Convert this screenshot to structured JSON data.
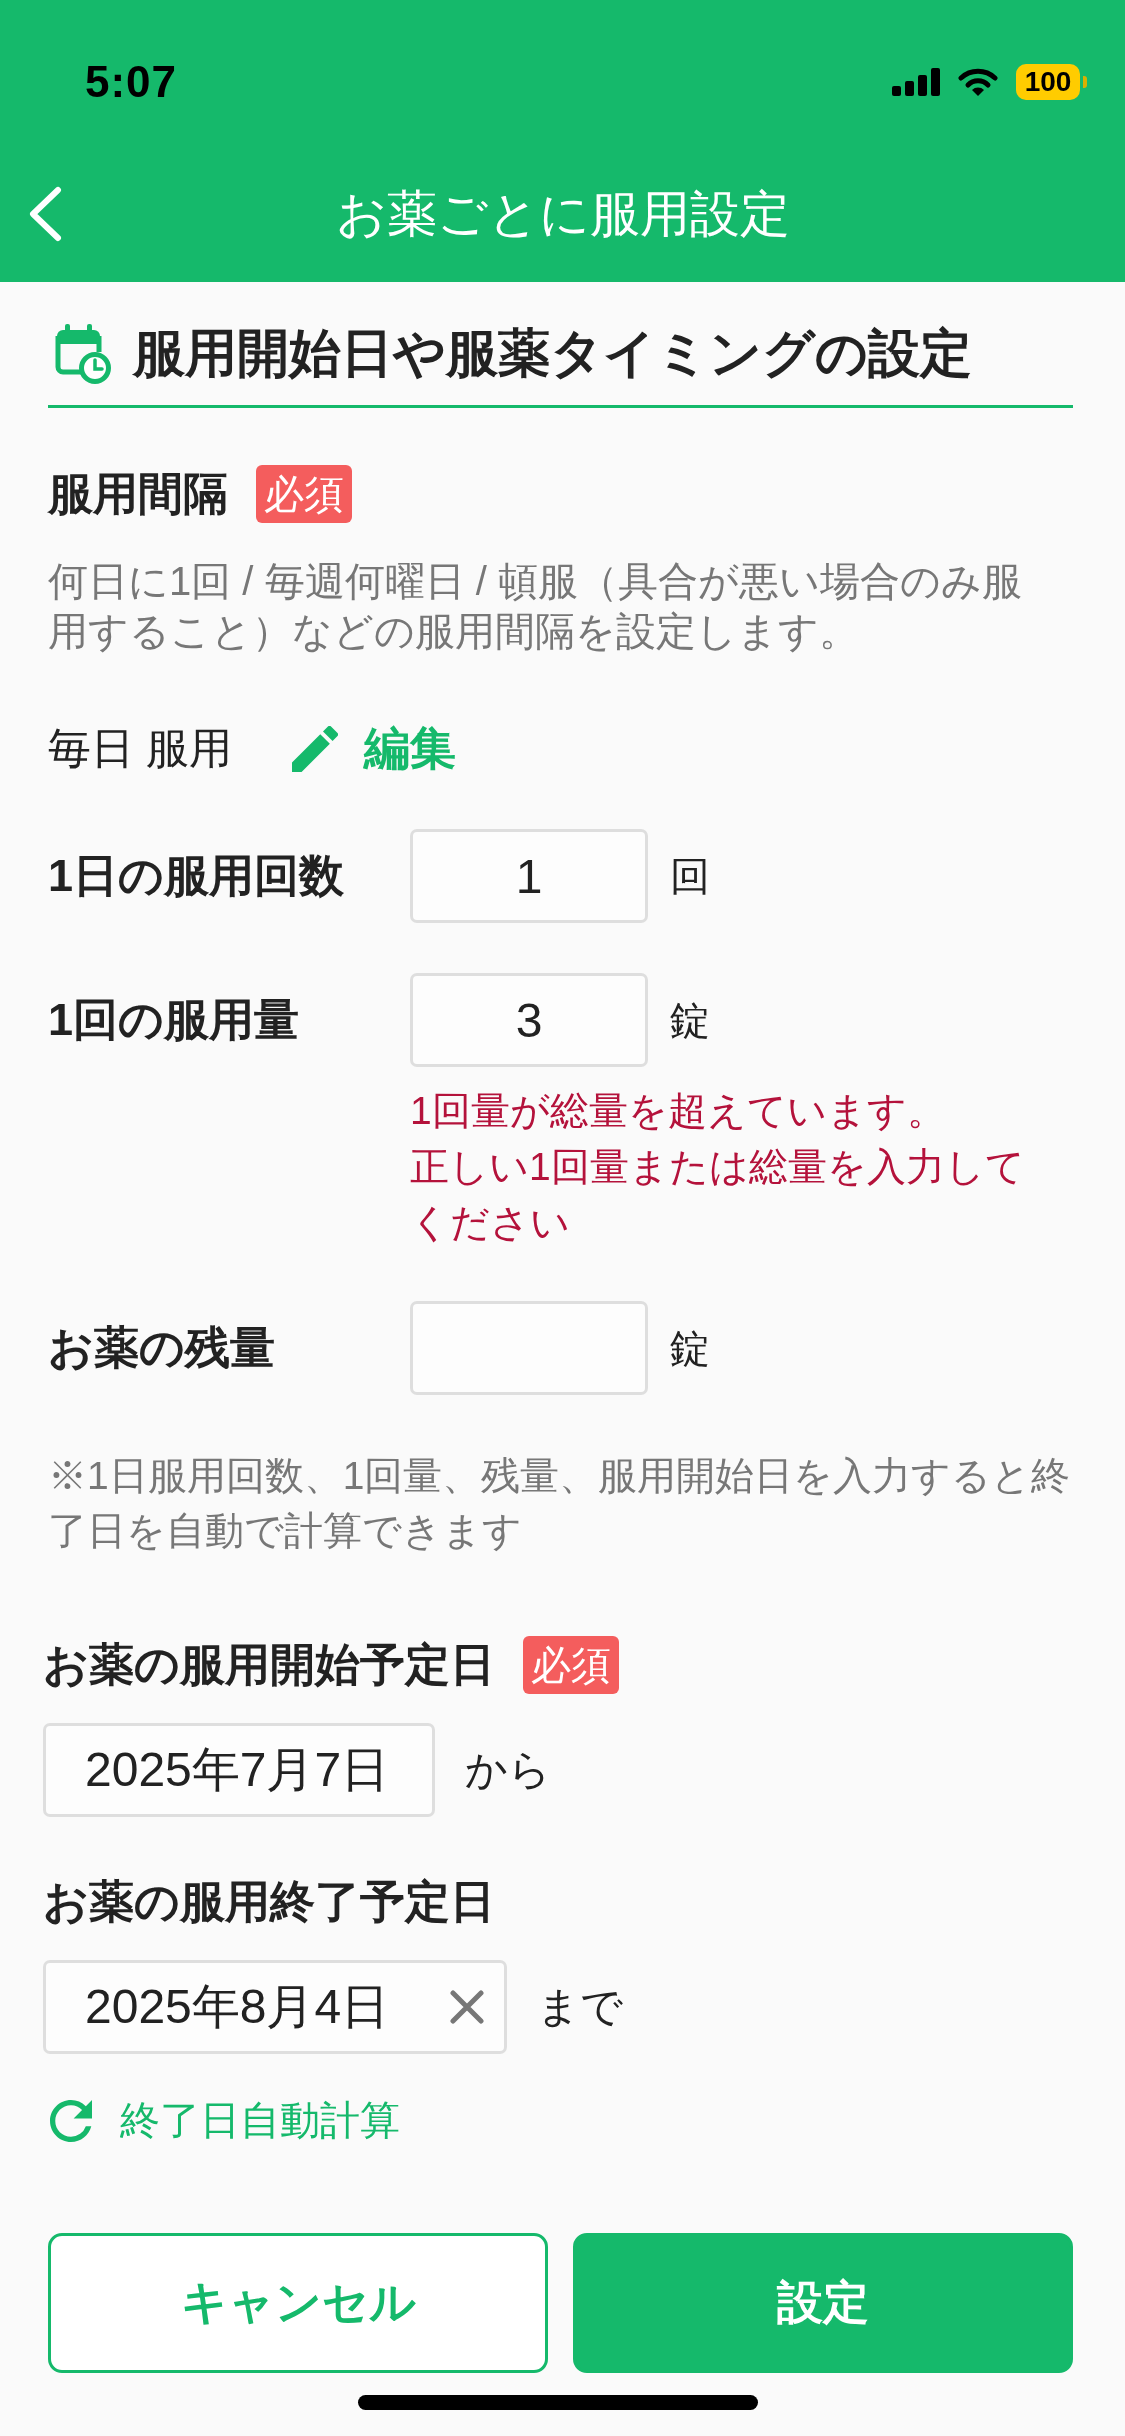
{
  "status_bar": {
    "time": "5:07",
    "battery": "100"
  },
  "nav": {
    "title": "お薬ごとに服用設定"
  },
  "section": {
    "title": "服用開始日や服薬タイミングの設定"
  },
  "interval": {
    "label": "服用間隔",
    "badge": "必須",
    "description": "何日に1回 / 毎週何曜日 / 頓服（具合が悪い場合のみ服用すること）などの服用間隔を設定します。",
    "value": "毎日 服用",
    "edit_label": "編集"
  },
  "dose_fields": [
    {
      "label": "1日の服用回数",
      "value": "1",
      "unit": "回"
    },
    {
      "label": "1回の服用量",
      "value": "3",
      "unit": "錠",
      "errors": [
        "1回量が総量を超えています。",
        "正しい1回量または総量を入力してください"
      ]
    },
    {
      "label": "お薬の残量",
      "unit": "錠"
    }
  ],
  "note": "※1日服用回数、1回量、残量、服用開始日を入力すると終了日を自動で計算できます",
  "date_fields": [
    {
      "label": "お薬の服用開始予定日",
      "badge": "必須",
      "value": "2025年7月7日",
      "suffix": "から",
      "clearable": false
    },
    {
      "label": "お薬の服用終了予定日",
      "value": "2025年8月4日",
      "suffix": "まで",
      "clearable": true
    }
  ],
  "auto_calc": {
    "label": "終了日自動計算"
  },
  "buttons": [
    {
      "label": "キャンセル",
      "kind": "secondary"
    },
    {
      "label": "設定",
      "kind": "primary"
    }
  ]
}
